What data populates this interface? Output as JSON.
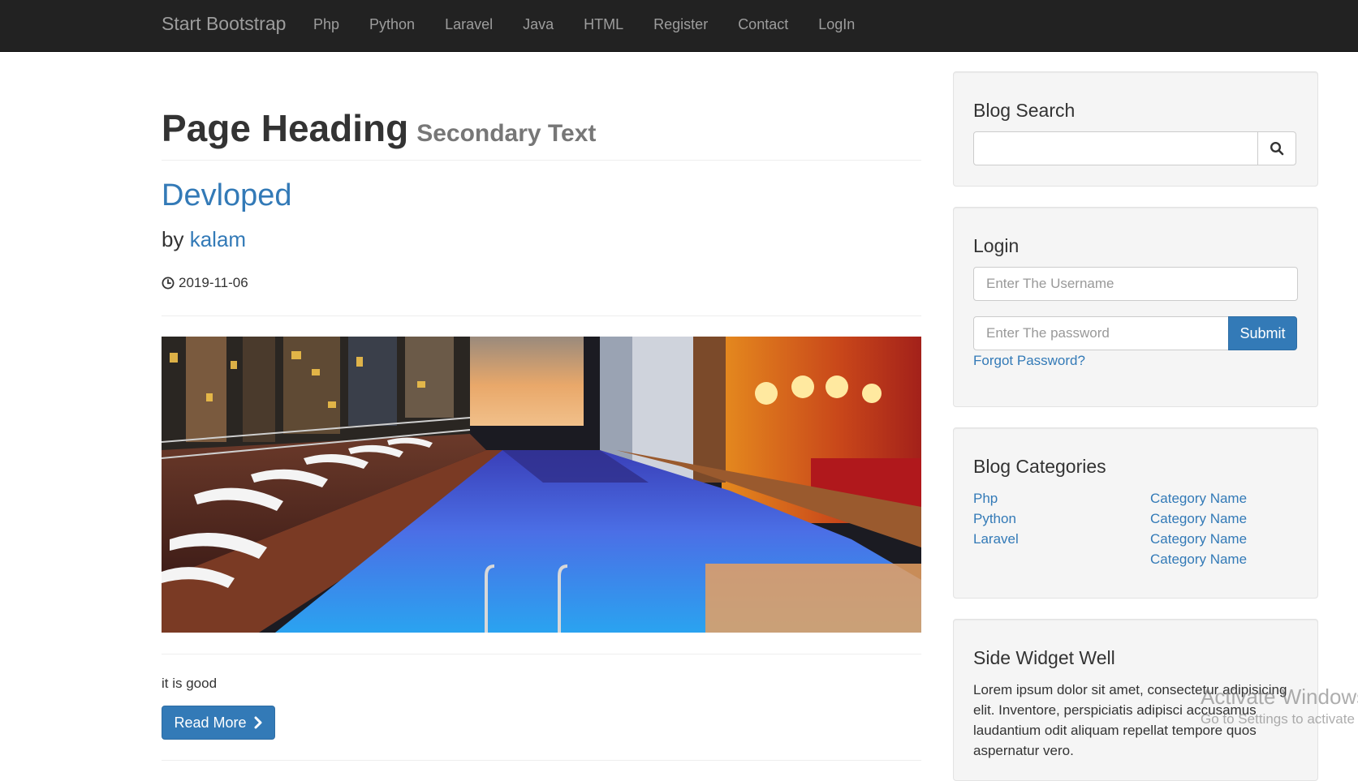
{
  "navbar": {
    "brand": "Start Bootstrap",
    "links": [
      "Php",
      "Python",
      "Laravel",
      "Java",
      "HTML",
      "Register",
      "Contact",
      "LogIn"
    ]
  },
  "main": {
    "page_heading": "Page Heading",
    "secondary_text": "Secondary Text",
    "post": {
      "title": "Devloped",
      "by_label": "by",
      "author": "kalam",
      "date": "2019-11-06",
      "excerpt": "it is good",
      "read_more_label": "Read More"
    }
  },
  "sidebar": {
    "search": {
      "title": "Blog Search",
      "value": ""
    },
    "login": {
      "title": "Login",
      "username_placeholder": "Enter The Username",
      "password_placeholder": "Enter The password",
      "submit_label": "Submit",
      "forgot_label": "Forgot Password?"
    },
    "categories": {
      "title": "Blog Categories",
      "left": [
        "Php",
        "Python",
        "Laravel"
      ],
      "right": [
        "Category Name",
        "Category Name",
        "Category Name",
        "Category Name"
      ]
    },
    "widget": {
      "title": "Side Widget Well",
      "text": "Lorem ipsum dolor sit amet, consectetur adipisicing elit. Inventore, perspiciatis adipisci accusamus laudantium odit aliquam repellat tempore quos aspernatur vero."
    }
  },
  "watermark": {
    "title": "Activate Windows",
    "subtitle": "Go to Settings to activate Windows."
  },
  "colors": {
    "navbar_bg": "#222222",
    "link": "#337ab7",
    "primary_button": "#337ab7",
    "well_bg": "#f5f5f5"
  },
  "icons": {
    "date": "clock-icon",
    "search": "search-icon",
    "read_more": "chevron-right-icon"
  }
}
